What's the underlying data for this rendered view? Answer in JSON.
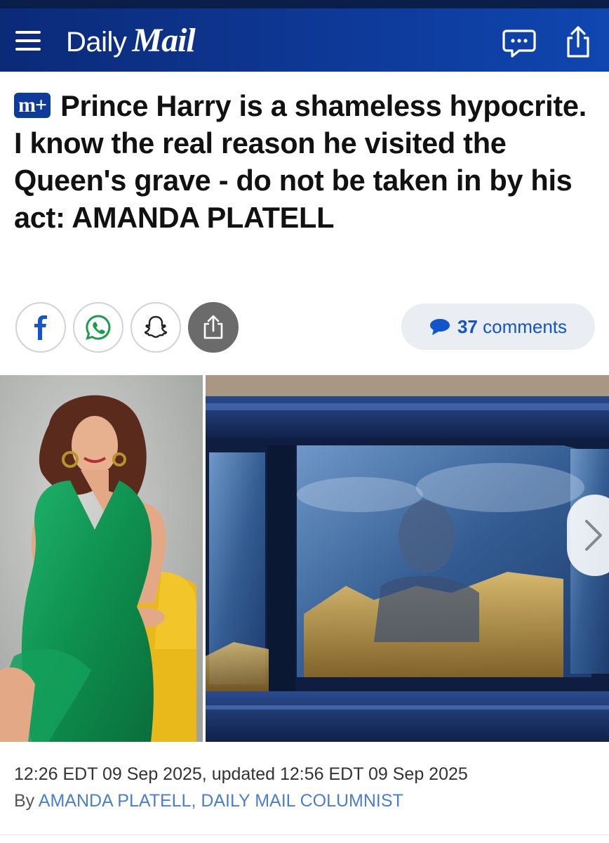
{
  "header": {
    "logo_daily": "Daily",
    "logo_mail": "Mail",
    "icons": [
      "menu-icon",
      "comments-icon",
      "share-icon"
    ],
    "brand_color": "#0e3a9a"
  },
  "article": {
    "badge": "m+",
    "headline": "Prince Harry is a shameless hypocrite. I know the real reason he visited the Queen's grave - do not be taken in by his act: AMANDA PLATELL",
    "share_icons": [
      "facebook-icon",
      "whatsapp-icon",
      "snapchat-icon",
      "share-icon"
    ],
    "comments_count": "37",
    "comments_label": "comments",
    "timestamp": "12:26 EDT 09 Sep 2025, updated 12:56 EDT 09 Sep 2025",
    "byline_prefix": "By",
    "author": "AMANDA PLATELL, DAILY MAIL COLUMNIST"
  },
  "colors": {
    "link": "#1155cc",
    "byline_link": "#4a7fd0",
    "pill_bg": "#eaedf1"
  }
}
